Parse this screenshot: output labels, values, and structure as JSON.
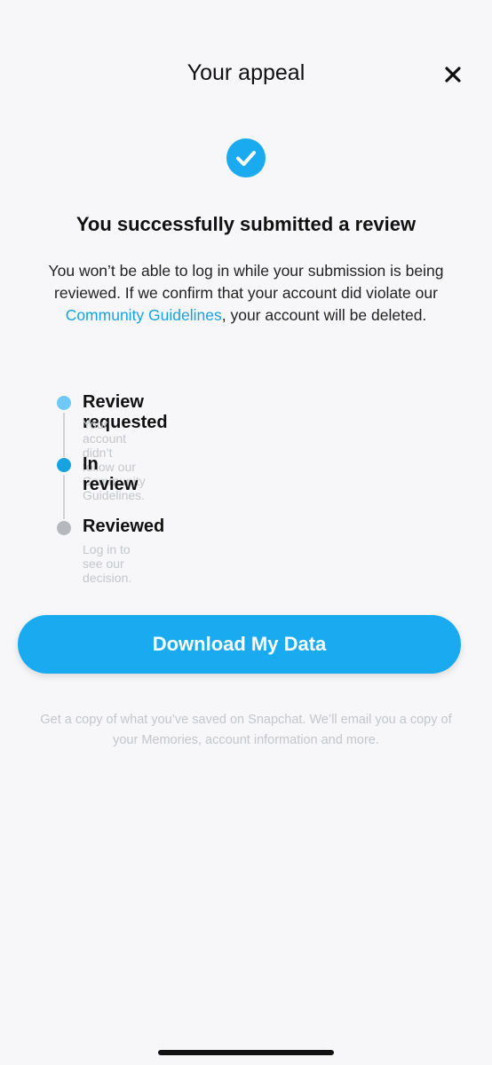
{
  "header": {
    "title": "Your appeal",
    "close_icon": "close-icon"
  },
  "status_icon": "check-circle-icon",
  "colors": {
    "accent": "#19aaf0",
    "link": "#16a3e0",
    "dot_requested": "#6ec9f7",
    "dot_in_review": "#16a3e0",
    "dot_reviewed": "#b5b9be"
  },
  "headline": "You successfully submitted a review",
  "body": {
    "before_link": "You won’t be able to log in while your submission is being reviewed. If we confirm that your account did violate our ",
    "link_text": "Community Guidelines",
    "after_link": ", your account will be deleted."
  },
  "timeline": [
    {
      "title": "Review requested",
      "subtitle": "Your account didn’t follow our Community Guidelines."
    },
    {
      "title": "In review",
      "subtitle": ""
    },
    {
      "title": "Reviewed",
      "subtitle": "Log in to see our decision."
    }
  ],
  "cta": {
    "label": "Download My Data"
  },
  "footnote": "Get a copy of what you’ve saved on Snapchat. We’ll email you a copy of your Memories, account information and more."
}
